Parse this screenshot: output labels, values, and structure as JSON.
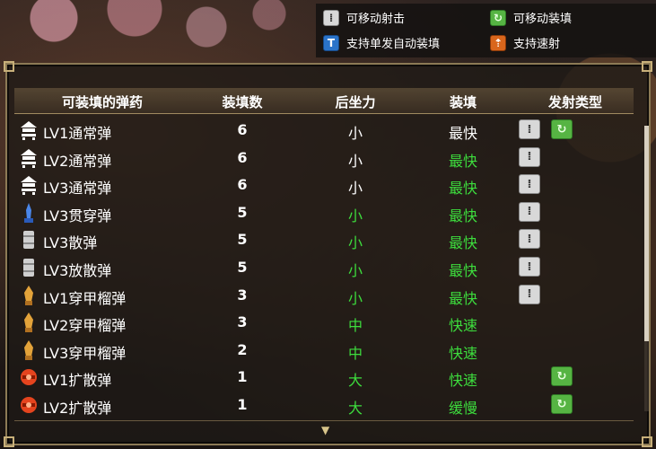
{
  "legend": {
    "move_shoot": "可移动射击",
    "move_reload": "可移动装填",
    "single_auto_reload": "支持单发自动装填",
    "rapid_fire": "支持速射"
  },
  "colors": {
    "highlight_green": "#3ddc3d",
    "normal_white": "#ffffff",
    "panel_border": "#8c7a55"
  },
  "columns": {
    "ammo": "可装填的弹药",
    "capacity": "装填数",
    "recoil": "后坐力",
    "reload": "装填",
    "fire_type": "发射类型"
  },
  "rows": [
    {
      "name": "LV1通常弹",
      "icon": "normal-ammo-icon",
      "capacity": "6",
      "recoil": "小",
      "recoil_green": false,
      "reload": "最快",
      "reload_green": false,
      "fire": [
        "move-shoot",
        "move-reload"
      ]
    },
    {
      "name": "LV2通常弹",
      "icon": "normal-ammo-icon",
      "capacity": "6",
      "recoil": "小",
      "recoil_green": false,
      "reload": "最快",
      "reload_green": true,
      "fire": [
        "move-shoot"
      ]
    },
    {
      "name": "LV3通常弹",
      "icon": "normal-ammo-icon",
      "capacity": "6",
      "recoil": "小",
      "recoil_green": false,
      "reload": "最快",
      "reload_green": true,
      "fire": [
        "move-shoot"
      ]
    },
    {
      "name": "LV3贯穿弹",
      "icon": "pierce-ammo-icon",
      "capacity": "5",
      "recoil": "小",
      "recoil_green": true,
      "reload": "最快",
      "reload_green": true,
      "fire": [
        "move-shoot"
      ]
    },
    {
      "name": "LV3散弹",
      "icon": "spread-ammo-icon",
      "capacity": "5",
      "recoil": "小",
      "recoil_green": true,
      "reload": "最快",
      "reload_green": true,
      "fire": [
        "move-shoot"
      ]
    },
    {
      "name": "LV3放散弹",
      "icon": "spread-ammo-icon",
      "capacity": "5",
      "recoil": "小",
      "recoil_green": true,
      "reload": "最快",
      "reload_green": true,
      "fire": [
        "move-shoot"
      ]
    },
    {
      "name": "LV1穿甲榴弹",
      "icon": "sticky-ammo-icon",
      "capacity": "3",
      "recoil": "小",
      "recoil_green": true,
      "reload": "最快",
      "reload_green": true,
      "fire": [
        "move-shoot"
      ]
    },
    {
      "name": "LV2穿甲榴弹",
      "icon": "sticky-ammo-icon",
      "capacity": "3",
      "recoil": "中",
      "recoil_green": true,
      "reload": "快速",
      "reload_green": true,
      "fire": []
    },
    {
      "name": "LV3穿甲榴弹",
      "icon": "sticky-ammo-icon",
      "capacity": "2",
      "recoil": "中",
      "recoil_green": true,
      "reload": "快速",
      "reload_green": true,
      "fire": []
    },
    {
      "name": "LV1扩散弹",
      "icon": "cluster-ammo-icon",
      "capacity": "1",
      "recoil": "大",
      "recoil_green": true,
      "reload": "快速",
      "reload_green": true,
      "fire": [
        "move-reload-only"
      ]
    },
    {
      "name": "LV2扩散弹",
      "icon": "cluster-ammo-icon",
      "capacity": "1",
      "recoil": "大",
      "recoil_green": true,
      "reload": "缓慢",
      "reload_green": true,
      "fire": [
        "move-reload-only"
      ]
    }
  ]
}
